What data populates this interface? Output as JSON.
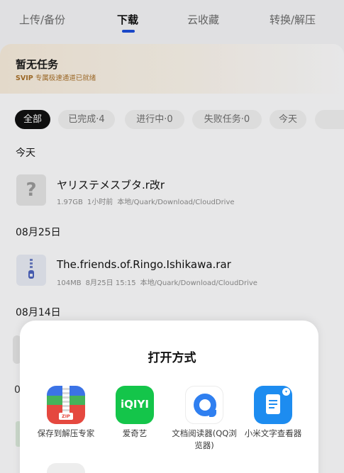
{
  "top_tabs": [
    {
      "label": "上传/备份"
    },
    {
      "label": "下载"
    },
    {
      "label": "云收藏"
    },
    {
      "label": "转换/解压"
    }
  ],
  "banner": {
    "title": "暂无任务",
    "subtitle_prefix": "SVIP",
    "subtitle_text": "专属极速通道已就绪"
  },
  "filters": [
    {
      "label": "全部"
    },
    {
      "label": "已完成·4"
    },
    {
      "label": "进行中·0"
    },
    {
      "label": "失败任务·0"
    },
    {
      "label": "今天"
    }
  ],
  "sections": [
    {
      "header": "今天",
      "files": [
        {
          "name": "ヤリステメスブタ.r改r",
          "size": "1.97GB",
          "time": "1小时前",
          "path": "本地/Quark/Download/CloudDrive",
          "icon": "unknown-file-icon"
        }
      ]
    },
    {
      "header": "08月25日",
      "files": [
        {
          "name": "The.friends.of.Ringo.Ishikawa.rar",
          "size": "104MB",
          "time": "8月25日 15:15",
          "path": "本地/Quark/Download/CloudDrive",
          "icon": "archive-file-icon"
        }
      ]
    },
    {
      "header": "08月14日",
      "files": []
    }
  ],
  "partial_char": "0",
  "sheet": {
    "title": "打开方式",
    "apps": [
      {
        "label": "保存到解压专家",
        "icon": "unzip-expert-icon",
        "zip_tag": "ZIP"
      },
      {
        "label": "爱奇艺",
        "icon": "iqiyi-icon",
        "logo_text": "iQIYI"
      },
      {
        "label": "文档阅读器(QQ浏览器)",
        "icon": "qq-doc-reader-icon"
      },
      {
        "label": "小米文字查看器",
        "icon": "mi-text-viewer-icon"
      }
    ]
  },
  "colors": {
    "accent": "#1d4ed8",
    "svip_gold": "#a8702a",
    "iqiyi_green": "#14c54a"
  }
}
